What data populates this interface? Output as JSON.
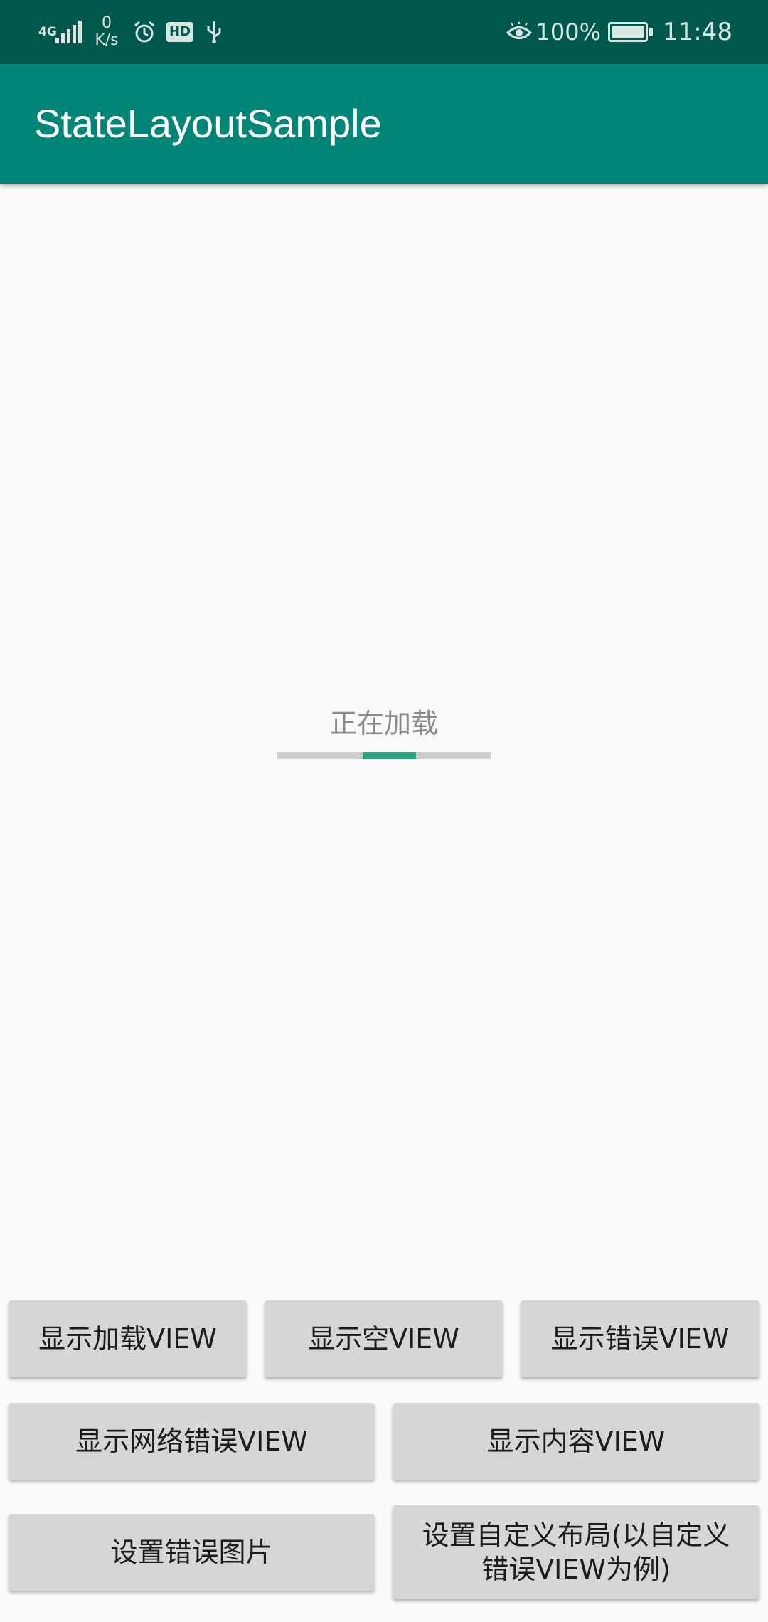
{
  "status_bar": {
    "network_type": "4G",
    "net_speed_value": "0",
    "net_speed_unit": "K/s",
    "hd_badge": "HD",
    "battery_percent": "100%",
    "time": "11:48"
  },
  "app_bar": {
    "title": "StateLayoutSample"
  },
  "loading": {
    "text": "正在加载",
    "progress_color": "#26a27f",
    "progress_fraction_start": 0.4,
    "progress_fraction_end": 0.65
  },
  "buttons": {
    "show_loading": "显示加载VIEW",
    "show_empty": "显示空VIEW",
    "show_error": "显示错误VIEW",
    "show_network_error": "显示网络错误VIEW",
    "show_content": "显示内容VIEW",
    "set_error_image": "设置错误图片",
    "set_custom_layout": "设置自定义布局(以自定义错误VIEW为例)"
  },
  "colors": {
    "status_bar": "#00574b",
    "app_bar": "#008577",
    "background": "#fafafa",
    "button": "#d6d6d6"
  }
}
